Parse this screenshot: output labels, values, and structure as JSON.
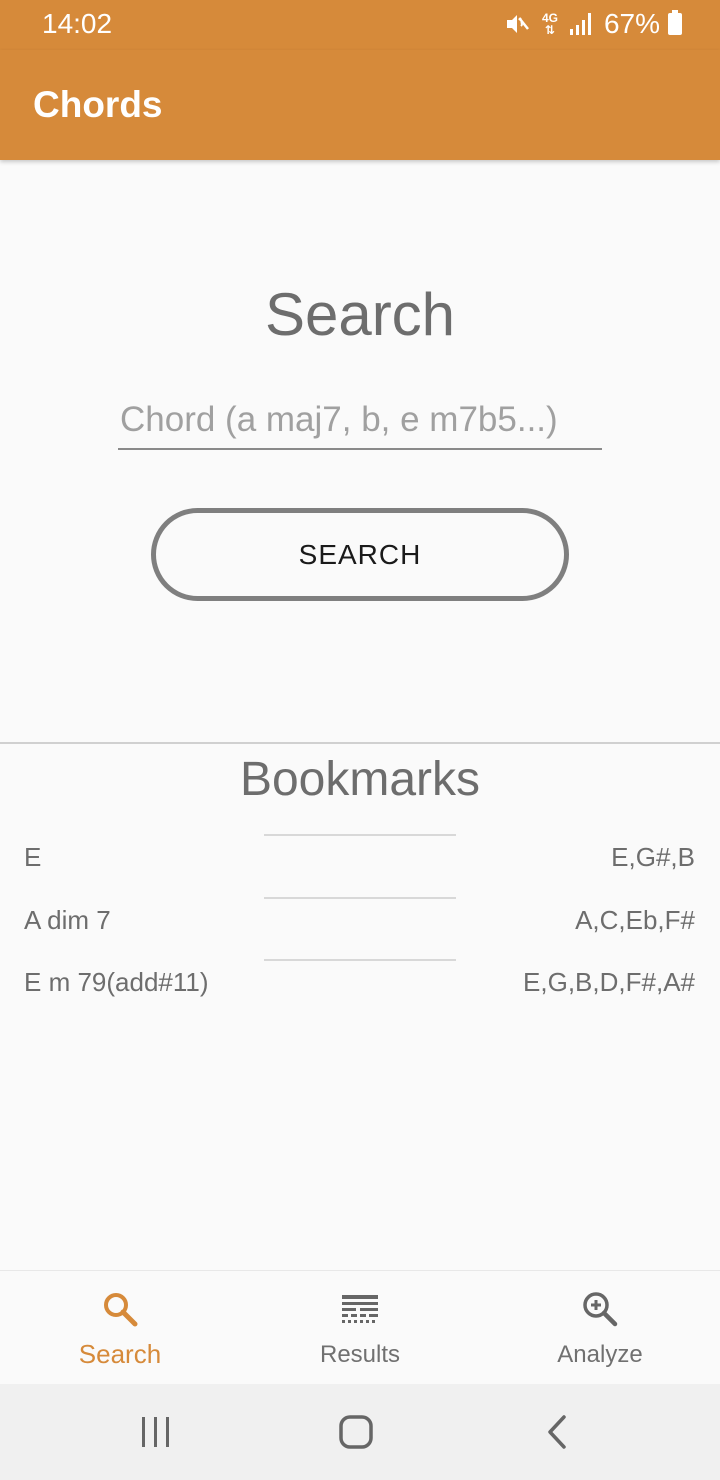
{
  "status_bar": {
    "time": "14:02",
    "network": "4G",
    "battery": "67%",
    "icons": [
      "mute-icon",
      "network-4g-icon",
      "signal-icon",
      "battery-icon"
    ]
  },
  "app_bar": {
    "title": "Chords"
  },
  "search": {
    "heading": "Search",
    "placeholder": "Chord (a maj7, b, e m7b5...)",
    "value": "",
    "button_label": "SEARCH"
  },
  "bookmarks": {
    "heading": "Bookmarks",
    "items": [
      {
        "name": "E",
        "notes": "E,G#,B"
      },
      {
        "name": "A dim 7",
        "notes": "A,C,Eb,F#"
      },
      {
        "name": "E m 79(add#11)",
        "notes": "E,G,B,D,F#,A#"
      }
    ]
  },
  "bottom_nav": {
    "items": [
      {
        "label": "Search",
        "icon": "search-icon",
        "active": true
      },
      {
        "label": "Results",
        "icon": "results-icon",
        "active": false
      },
      {
        "label": "Analyze",
        "icon": "zoom-in-icon",
        "active": false
      }
    ]
  },
  "system_nav": {
    "icons": [
      "recent-apps-icon",
      "home-icon",
      "back-icon"
    ]
  },
  "colors": {
    "accent": "#d68a3a",
    "text": "#6d6d6d",
    "background": "#fafafa"
  }
}
